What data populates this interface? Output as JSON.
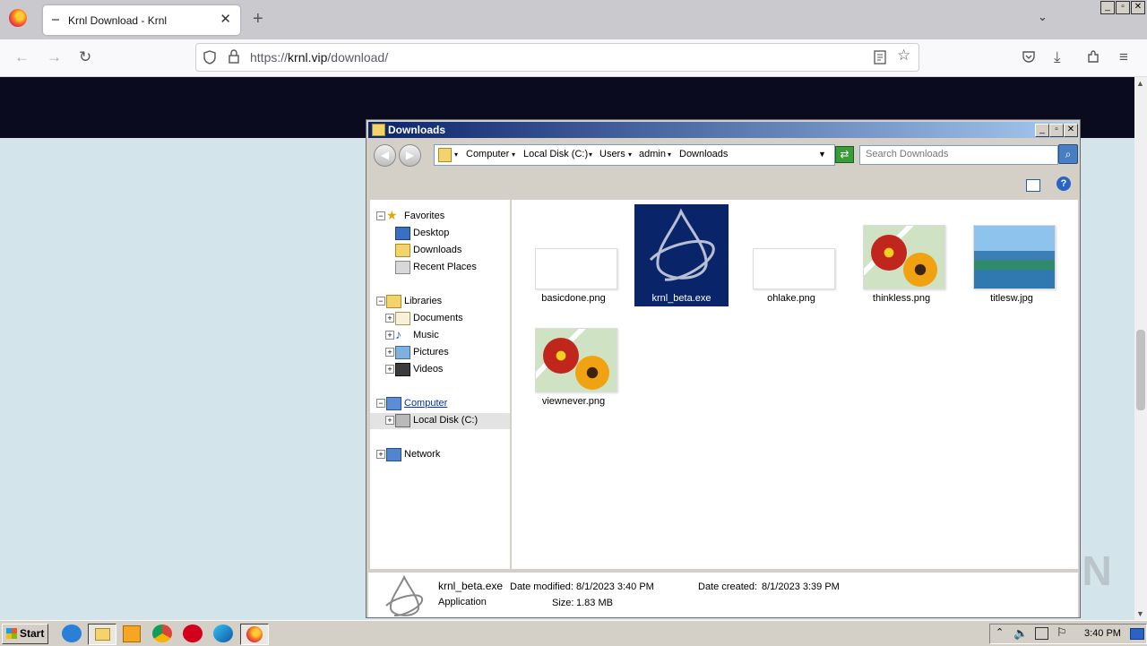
{
  "browser": {
    "tab_title": "Krnl Download - Krnl",
    "tab_close": "✕",
    "new_tab": "+",
    "url_prefix": "https://",
    "url_domain": "krnl.vip",
    "url_path": "/download/",
    "tab_list": "⌄"
  },
  "window_controls": {
    "minimize": "_",
    "restore": "▫",
    "close": "✕"
  },
  "explorer": {
    "title": "Downloads",
    "breadcrumb": [
      "Computer",
      "Local Disk (C:)",
      "Users",
      "admin",
      "Downloads"
    ],
    "search_placeholder": "Search Downloads",
    "tree": {
      "favorites": "Favorites",
      "desktop": "Desktop",
      "downloads": "Downloads",
      "recent_places": "Recent Places",
      "libraries": "Libraries",
      "documents": "Documents",
      "music": "Music",
      "pictures": "Pictures",
      "videos": "Videos",
      "computer": "Computer",
      "local_disk": "Local Disk (C:)",
      "network": "Network"
    },
    "files": [
      {
        "name": "basicdone.png"
      },
      {
        "name": "krnl_beta.exe"
      },
      {
        "name": "ohlake.png"
      },
      {
        "name": "thinkless.png"
      },
      {
        "name": "titlesw.jpg"
      },
      {
        "name": "viewnever.png"
      }
    ],
    "details": {
      "name": "krnl_beta.exe",
      "type": "Application",
      "modified_label": "Date modified:",
      "modified_value": "8/1/2023 3:40 PM",
      "created_label": "Date created:",
      "created_value": "8/1/2023 3:39 PM",
      "size_label": "Size:",
      "size_value": "1.83 MB"
    }
  },
  "taskbar": {
    "start": "Start",
    "clock": "3:40 PM"
  },
  "watermark": "ANY RUN"
}
